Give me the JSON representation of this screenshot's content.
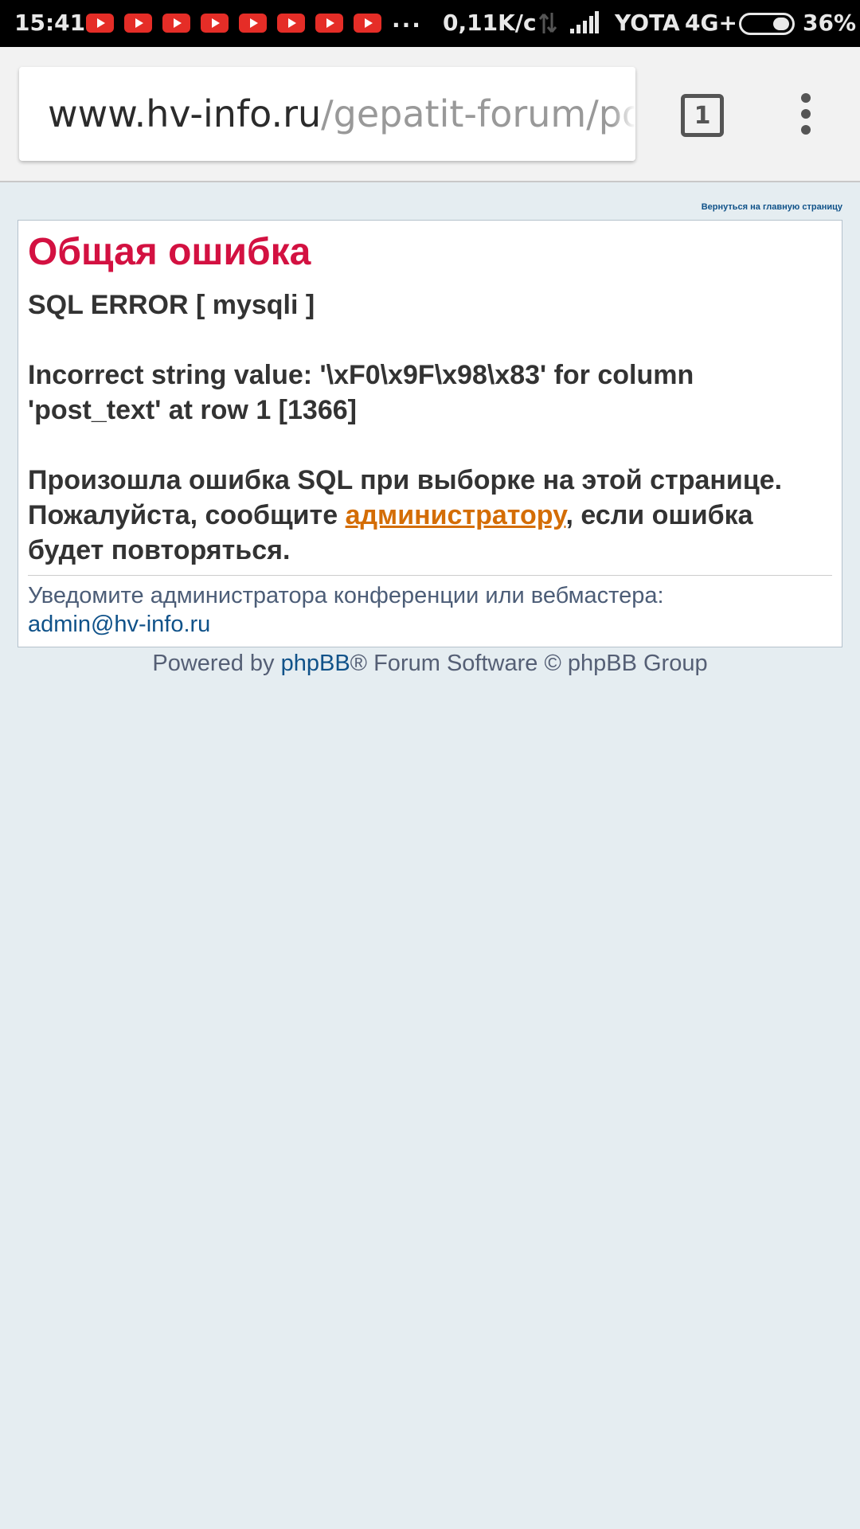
{
  "status_bar": {
    "time": "15:41",
    "notification_icons": [
      "youtube-icon",
      "youtube-icon",
      "youtube-icon",
      "youtube-icon",
      "youtube-icon",
      "youtube-icon",
      "youtube-icon",
      "youtube-icon"
    ],
    "more": "...",
    "net_speed": "0,11K/c",
    "carrier": "YOTA",
    "network": "4G+",
    "battery": "36%",
    "battery_level": 0.36
  },
  "browser": {
    "url_domain": "www.hv-info.ru",
    "url_path": "/gepatit-forum/posting.php",
    "tab_count": "1"
  },
  "page": {
    "return_link": "Вернуться на главную страницу",
    "title": "Общая ошибка",
    "sql_error": "SQL ERROR [ mysqli ]",
    "error_message": "Incorrect string value: '\\xF0\\x9F\\x98\\x83' for column 'post_text' at row 1 [1366]",
    "info_before": "Произошла ошибка SQL при выборке на этой странице. Пожалуйста, сообщите ",
    "info_link": "администратору",
    "info_after": ", если ошибка будет повторяться.",
    "notify_label": "Уведомите администратора конференции или вебмастера:",
    "notify_email": "admin@hv-info.ru"
  },
  "footer": {
    "powered_by": "Powered by ",
    "phpbb_link": "phpBB",
    "rest": "® Forum Software © phpBB Group"
  },
  "colors": {
    "title": "#d31141",
    "link": "#105289",
    "admin_link": "#d46d05",
    "page_bg": "#e5edf1"
  }
}
